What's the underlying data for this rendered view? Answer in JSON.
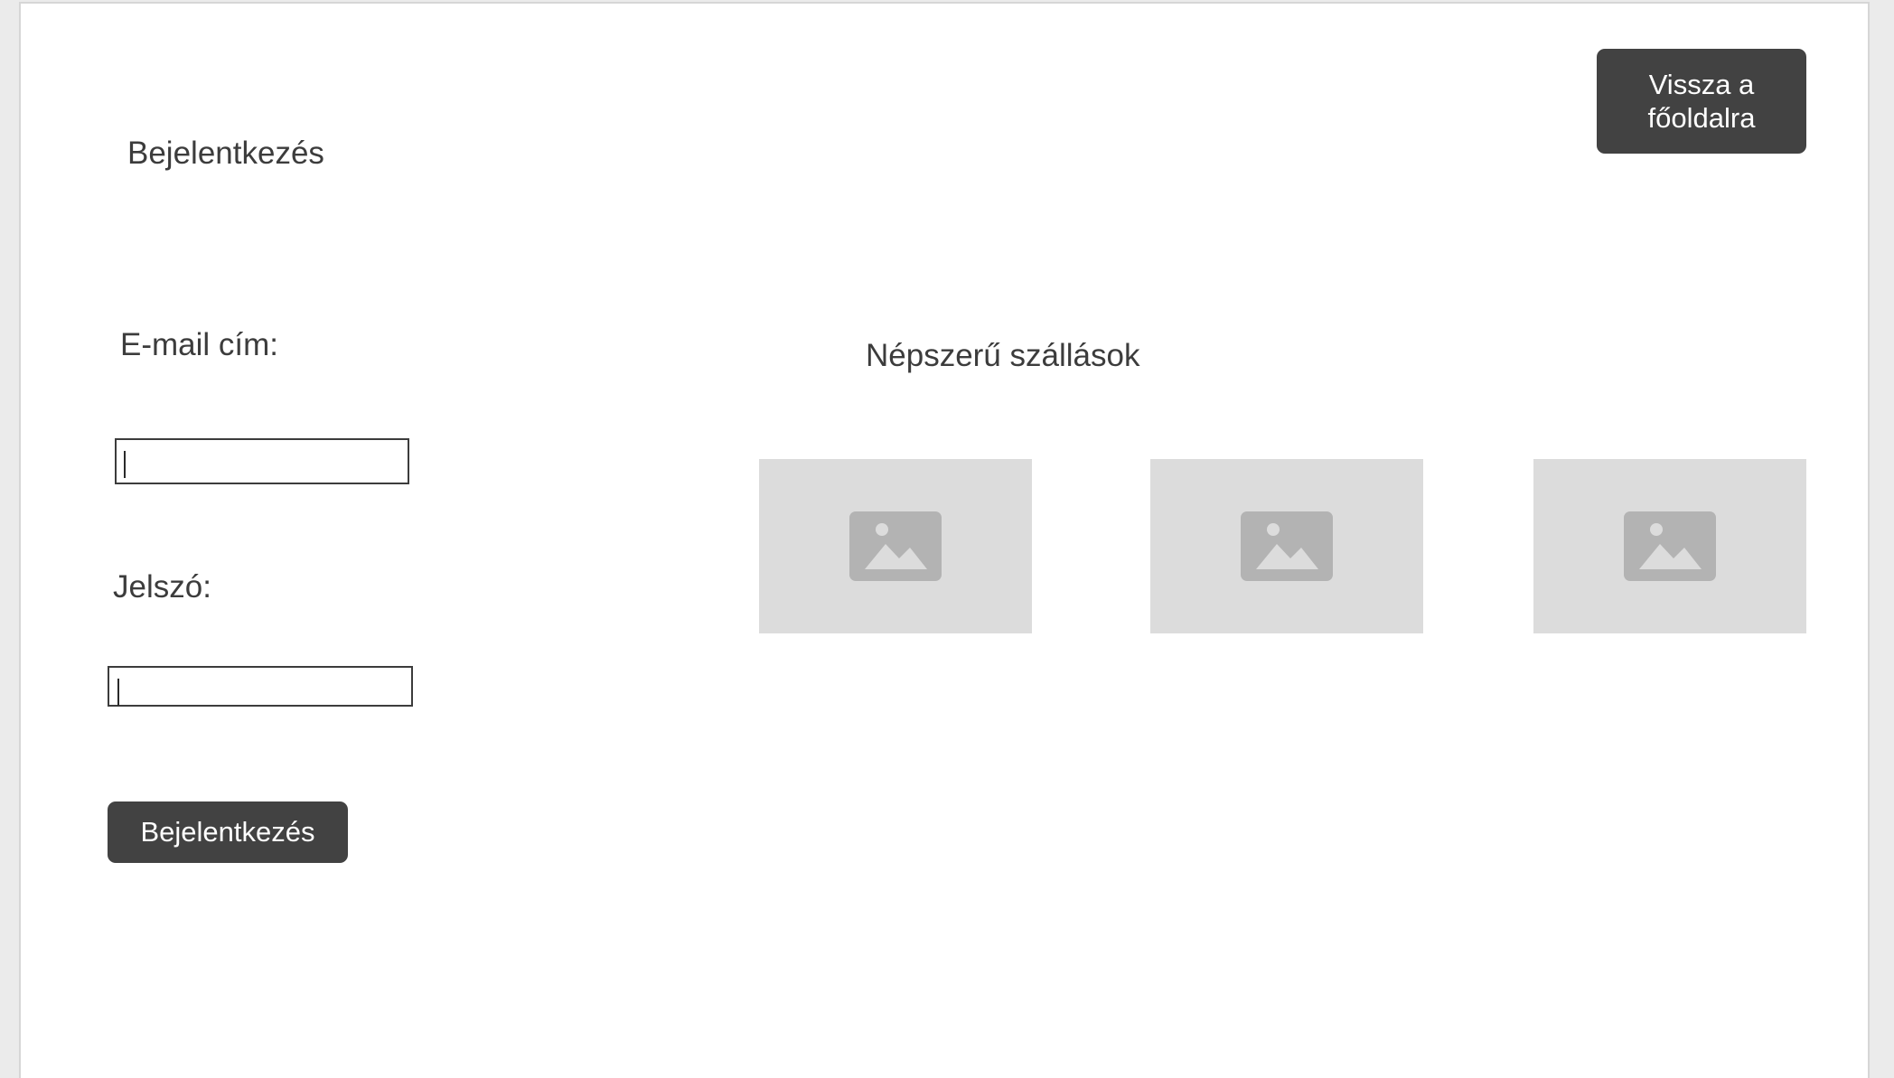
{
  "header": {
    "page_title": "Bejelentkezés",
    "back_button_label": "Vissza a főoldalra"
  },
  "login_form": {
    "email_label": "E-mail cím:",
    "email_value": "",
    "password_label": "Jelszó:",
    "password_value": "",
    "submit_label": "Bejelentkezés"
  },
  "popular": {
    "heading": "Népszerű szállások",
    "items": [
      {
        "icon": "image-placeholder-icon"
      },
      {
        "icon": "image-placeholder-icon"
      },
      {
        "icon": "image-placeholder-icon"
      }
    ]
  },
  "colors": {
    "button_bg": "#424242",
    "text": "#3c3c3c",
    "placeholder_bg": "#dcdcdc",
    "placeholder_icon": "#b3b3b3"
  }
}
